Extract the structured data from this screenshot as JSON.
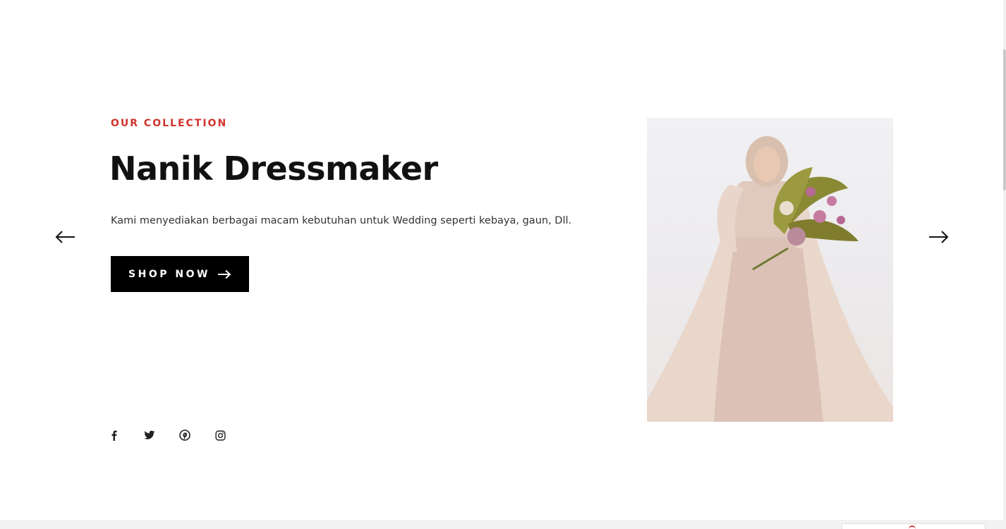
{
  "hero": {
    "eyebrow": "OUR COLLECTION",
    "title": "Nanik Dressmaker",
    "description": "Kami menyediakan berbagai macam kebutuhan untuk Wedding seperti kebaya, gaun, Dll.",
    "cta_label": "SHOP NOW",
    "image_icon": "bride-in-gown-with-bouquet"
  },
  "slider": {
    "prev_icon": "arrow-left-icon",
    "next_icon": "arrow-right-icon"
  },
  "socials": [
    {
      "icon": "facebook-icon"
    },
    {
      "icon": "twitter-icon"
    },
    {
      "icon": "pinterest-icon"
    },
    {
      "icon": "instagram-icon"
    }
  ],
  "colors": {
    "accent": "#d0342c",
    "button_bg": "#000000",
    "text": "#111111"
  }
}
